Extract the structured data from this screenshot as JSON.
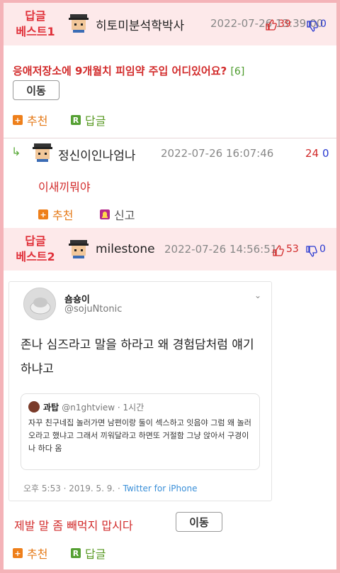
{
  "post1": {
    "best_label_line1": "답글",
    "best_label_line2": "베스트1",
    "author": "히토미분석학박사",
    "date": "2022-07-26 13:39:00",
    "up": "39",
    "down": "0",
    "title": "응애저장소에 9개월치 피임약 주입 어디있어요?",
    "comment_count": "[6]",
    "move_label": "이동",
    "recommend_label": "추천",
    "reply_label": "답글"
  },
  "reply1": {
    "author": "정신이인나엄나",
    "date": "2022-07-26 16:07:46",
    "up": "24",
    "down": "0",
    "text": "이새끼뭐야",
    "recommend_label": "추천",
    "report_label": "신고"
  },
  "post2": {
    "best_label_line1": "답글",
    "best_label_line2": "베스트2",
    "author": "milestone",
    "date": "2022-07-26 14:56:51",
    "up": "53",
    "down": "0",
    "footer_text": "제발 말 좀 빼먹지 맙시다",
    "move_label": "이동",
    "recommend_label": "추천",
    "reply_label": "답글"
  },
  "tweet": {
    "name": "숌숑이",
    "handle": "@sojuNtonic",
    "body": "존나 심즈라고 말을 하라고 왜 경험담처럼 얘기하냐고",
    "quote_name": "과탑",
    "quote_handle": "@n1ghtview · 1시간",
    "quote_body": "자꾸 친구네집 놀러가면 남편이랑 둘이 섹스하고 잇음야 그럼 왜 놀러오라고 했냐고 그래서 끼워달라고 하면또 거절함 그냥 앉아서 구경이나 하다 옴",
    "footer_time": "오후 5:53 · 2019. 5. 9. · ",
    "footer_link": "Twitter for iPhone"
  },
  "colors": {
    "accent_red": "#e0313a",
    "border_pink": "#f4b3b8",
    "header_bg": "#fde9ea",
    "green": "#5a9a25",
    "orange": "#e57a18"
  },
  "icons": [
    "avatar-icon",
    "thumbs-up-icon",
    "thumbs-down-icon",
    "plus-icon",
    "reply-r-icon",
    "report-bell-icon",
    "reply-arrow-icon",
    "chevron-down-icon"
  ]
}
